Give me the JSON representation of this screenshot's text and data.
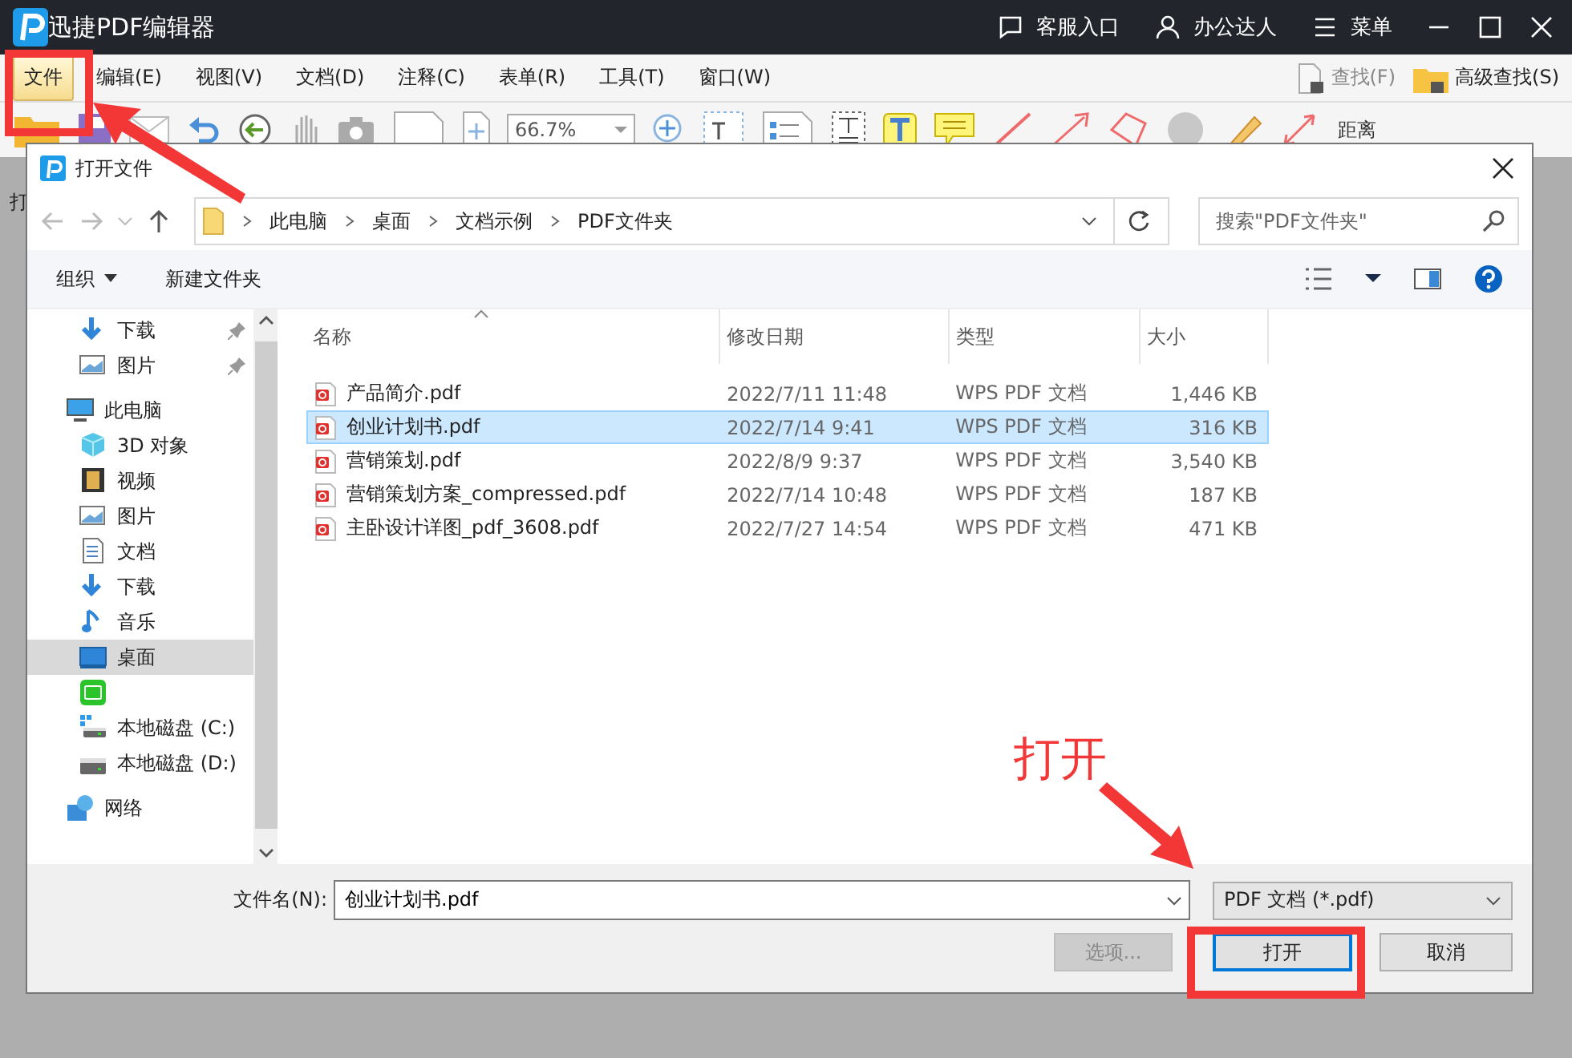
{
  "app": {
    "title": "迅捷PDF编辑器",
    "header_links": [
      {
        "kind": "chat",
        "label": "客服入口"
      },
      {
        "kind": "user",
        "label": "办公达人"
      },
      {
        "kind": "menu",
        "label": "菜单"
      }
    ]
  },
  "menu": [
    {
      "label": "文件",
      "selected": true
    },
    {
      "label": "编辑(E)",
      "selected": false
    },
    {
      "label": "视图(V)",
      "selected": false
    },
    {
      "label": "文档(D)",
      "selected": false
    },
    {
      "label": "注释(C)",
      "selected": false
    },
    {
      "label": "表单(R)",
      "selected": false
    },
    {
      "label": "工具(T)",
      "selected": false
    },
    {
      "label": "窗口(W)",
      "selected": false
    }
  ],
  "toolbar": {
    "zoom": "66.7%",
    "find": "查找(F)",
    "advanced_find": "高级查找(S)",
    "distance": "距离",
    "side_label": "打"
  },
  "dialog": {
    "title": "打开文件",
    "breadcrumb": [
      "此电脑",
      "桌面",
      "文档示例",
      "PDF文件夹"
    ],
    "search": {
      "placeholder": "搜索\"PDF文件夹\""
    },
    "commands": [
      {
        "kind": "dropdown",
        "label": "组织"
      },
      {
        "kind": "plain",
        "label": "新建文件夹"
      }
    ],
    "quick_access": [
      {
        "kind": "download",
        "label": "下载",
        "pinned": true,
        "selected": false
      },
      {
        "kind": "picture",
        "label": "图片",
        "pinned": true,
        "selected": false
      }
    ],
    "nav": [
      {
        "kind": "pc",
        "label": "此电脑",
        "selected": false,
        "children": [
          {
            "kind": "cube",
            "label": "3D 对象",
            "selected": false
          },
          {
            "kind": "video",
            "label": "视频",
            "selected": false
          },
          {
            "kind": "picture",
            "label": "图片",
            "selected": false
          },
          {
            "kind": "doc",
            "label": "文档",
            "selected": false
          },
          {
            "kind": "download",
            "label": "下载",
            "selected": false
          },
          {
            "kind": "music",
            "label": "音乐",
            "selected": false
          },
          {
            "kind": "desktop",
            "label": "桌面",
            "selected": true
          },
          {
            "kind": "app",
            "selected": false
          },
          {
            "kind": "drive-c",
            "label": "本地磁盘 (C:)",
            "selected": false
          },
          {
            "kind": "drive",
            "label": "本地磁盘 (D:)",
            "selected": false
          }
        ]
      },
      {
        "kind": "network",
        "label": "网络",
        "selected": false
      }
    ],
    "columns": [
      "名称",
      "修改日期",
      "类型",
      "大小"
    ],
    "files": [
      {
        "name": "产品简介.pdf",
        "date": "2022/7/11 11:48",
        "type": "WPS PDF 文档",
        "size": "1,446 KB",
        "selected": false
      },
      {
        "name": "创业计划书.pdf",
        "date": "2022/7/14 9:41",
        "type": "WPS PDF 文档",
        "size": "316 KB",
        "selected": true
      },
      {
        "name": "营销策划.pdf",
        "date": "2022/8/9 9:37",
        "type": "WPS PDF 文档",
        "size": "3,540 KB",
        "selected": false
      },
      {
        "name": "营销策划方案_compressed.pdf",
        "date": "2022/7/14 10:48",
        "type": "WPS PDF 文档",
        "size": "187 KB",
        "selected": false
      },
      {
        "name": "主卧设计详图_pdf_3608.pdf",
        "date": "2022/7/27 14:54",
        "type": "WPS PDF 文档",
        "size": "471 KB",
        "selected": false
      }
    ],
    "filename_label": "文件名(N):",
    "filename": "创业计划书.pdf",
    "filetype": "PDF 文档 (*.pdf)",
    "buttons": [
      {
        "kind": "options",
        "label": "选项...",
        "disabled": true
      },
      {
        "kind": "open",
        "label": "打开",
        "disabled": false
      },
      {
        "kind": "cancel",
        "label": "取消",
        "disabled": false
      }
    ]
  },
  "callout": "打开"
}
